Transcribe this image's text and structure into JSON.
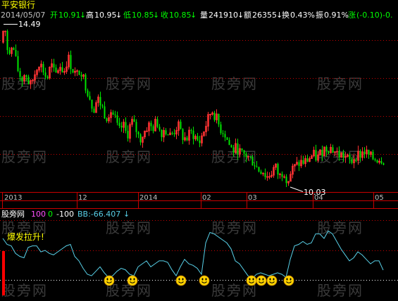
{
  "header": {
    "date": "2014/05/07",
    "open_label": "开",
    "open_value": "10.91",
    "high_label": "高",
    "high_value": "10.95",
    "low_label": "低",
    "low_value": "10.85",
    "close_label": "收",
    "close_value": "10.85",
    "volume_label": "量",
    "volume_value": "241910",
    "amount_label": "额",
    "amount_value": "26355",
    "turnover_label": "换",
    "turnover_value": "0.43%",
    "amplitude_label": "振",
    "amplitude_value": "0.91%",
    "change_label": "涨",
    "change_value": "(-0.10)-0."
  },
  "stock_name": "平安银行",
  "watermark": "股旁网",
  "indicator": {
    "name": "股旁网",
    "value_100": "100",
    "value_0": "0",
    "value_neg100": "-100",
    "bb_text": "BB:-66.407",
    "alert_text": "爆发拉升!"
  },
  "colors": {
    "background": "#000000",
    "up_candle": "#ff3232",
    "down_candle": "#00e600",
    "grid": "#c80000",
    "axis": "#c80000",
    "indicator_line": "#58d0e8",
    "smiley": "#ffd400",
    "date_text": "#c0c0c0",
    "yellow_text": "#ffff00",
    "green_text": "#00ff00",
    "magenta_text": "#ff50ff"
  },
  "chart_data": {
    "type": "candlestick",
    "annotations": {
      "high_label": "14.49",
      "low_label": "10.03"
    },
    "x_tick_labels": [
      "2013",
      "12",
      "2014",
      "02",
      "03",
      "04",
      "05"
    ],
    "price_trend": [
      [
        0,
        13.8
      ],
      [
        6,
        14.1
      ],
      [
        12,
        13.6
      ],
      [
        18,
        13.9
      ],
      [
        24,
        13.3
      ],
      [
        30,
        13.0
      ],
      [
        36,
        13.2
      ],
      [
        42,
        12.8
      ],
      [
        48,
        13.1
      ],
      [
        54,
        13.5
      ],
      [
        60,
        13.3
      ],
      [
        66,
        13.0
      ],
      [
        72,
        13.4
      ],
      [
        78,
        13.1
      ],
      [
        84,
        13.4
      ],
      [
        90,
        13.2
      ],
      [
        96,
        13.6
      ],
      [
        102,
        13.3
      ],
      [
        108,
        13.1
      ],
      [
        114,
        13.3
      ],
      [
        120,
        12.9
      ],
      [
        126,
        12.6
      ],
      [
        132,
        12.2
      ],
      [
        138,
        12.5
      ],
      [
        144,
        12.3
      ],
      [
        150,
        12.0
      ],
      [
        156,
        12.2
      ],
      [
        162,
        12.0
      ],
      [
        168,
        11.6
      ],
      [
        174,
        11.8
      ],
      [
        180,
        11.5
      ],
      [
        186,
        11.9
      ],
      [
        192,
        11.7
      ],
      [
        198,
        11.4
      ],
      [
        204,
        11.6
      ],
      [
        210,
        11.8
      ],
      [
        216,
        11.7
      ],
      [
        222,
        11.9
      ],
      [
        228,
        11.6
      ],
      [
        234,
        11.7
      ],
      [
        240,
        11.5
      ],
      [
        246,
        11.6
      ],
      [
        252,
        11.8
      ],
      [
        258,
        11.5
      ],
      [
        264,
        11.4
      ],
      [
        270,
        11.6
      ],
      [
        276,
        11.5
      ],
      [
        282,
        11.3
      ],
      [
        288,
        11.6
      ],
      [
        294,
        11.9
      ],
      [
        300,
        12.2
      ],
      [
        306,
        12.0
      ],
      [
        312,
        11.7
      ],
      [
        318,
        11.6
      ],
      [
        324,
        11.3
      ],
      [
        330,
        11.1
      ],
      [
        336,
        11.2
      ],
      [
        342,
        11.0
      ],
      [
        348,
        11.0
      ],
      [
        354,
        10.9
      ],
      [
        360,
        10.8
      ],
      [
        366,
        10.6
      ],
      [
        372,
        10.6
      ],
      [
        378,
        10.4
      ],
      [
        384,
        10.5
      ],
      [
        390,
        10.7
      ],
      [
        396,
        10.4
      ],
      [
        402,
        10.6
      ],
      [
        408,
        10.3
      ],
      [
        414,
        10.6
      ],
      [
        420,
        10.7
      ],
      [
        426,
        10.8
      ],
      [
        432,
        10.8
      ],
      [
        438,
        10.9
      ],
      [
        444,
        11.0
      ],
      [
        450,
        10.9
      ],
      [
        456,
        11.1
      ],
      [
        462,
        11.2
      ],
      [
        468,
        11.2
      ],
      [
        474,
        11.1
      ],
      [
        480,
        11.0
      ],
      [
        486,
        11.0
      ],
      [
        492,
        10.9
      ],
      [
        498,
        10.8
      ],
      [
        504,
        11.0
      ],
      [
        510,
        11.0
      ],
      [
        516,
        11.1
      ],
      [
        522,
        11.0
      ],
      [
        528,
        10.9
      ],
      [
        534,
        10.9
      ],
      [
        540,
        10.9
      ],
      [
        546,
        10.85
      ]
    ],
    "indicator_series": {
      "name": "BB",
      "ylim": [
        -100,
        100
      ],
      "points": [
        [
          4,
          40
        ],
        [
          10,
          20
        ],
        [
          16,
          15
        ],
        [
          22,
          -10
        ],
        [
          28,
          -20
        ],
        [
          34,
          -25
        ],
        [
          40,
          10
        ],
        [
          46,
          15
        ],
        [
          52,
          15
        ],
        [
          58,
          -5
        ],
        [
          64,
          0
        ],
        [
          70,
          -10
        ],
        [
          76,
          -15
        ],
        [
          82,
          -5
        ],
        [
          88,
          5
        ],
        [
          94,
          15
        ],
        [
          100,
          20
        ],
        [
          106,
          -20
        ],
        [
          112,
          -35
        ],
        [
          118,
          -60
        ],
        [
          124,
          -80
        ],
        [
          130,
          -85
        ],
        [
          136,
          -70
        ],
        [
          142,
          -55
        ],
        [
          148,
          -75
        ],
        [
          154,
          -90
        ],
        [
          160,
          -85
        ],
        [
          166,
          -70
        ],
        [
          172,
          -60
        ],
        [
          178,
          -65
        ],
        [
          184,
          -80
        ],
        [
          190,
          -85
        ],
        [
          196,
          -55
        ],
        [
          202,
          -45
        ],
        [
          208,
          -35
        ],
        [
          214,
          -55
        ],
        [
          220,
          -45
        ],
        [
          226,
          -35
        ],
        [
          232,
          -35
        ],
        [
          238,
          -40
        ],
        [
          244,
          -65
        ],
        [
          250,
          -85
        ],
        [
          256,
          -55
        ],
        [
          262,
          -30
        ],
        [
          268,
          -45
        ],
        [
          274,
          -50
        ],
        [
          280,
          -60
        ],
        [
          286,
          -80
        ],
        [
          292,
          25
        ],
        [
          298,
          60
        ],
        [
          304,
          55
        ],
        [
          310,
          45
        ],
        [
          316,
          35
        ],
        [
          322,
          25
        ],
        [
          328,
          5
        ],
        [
          334,
          -35
        ],
        [
          340,
          -45
        ],
        [
          346,
          -65
        ],
        [
          352,
          -85
        ],
        [
          358,
          -95
        ],
        [
          364,
          -80
        ],
        [
          370,
          -75
        ],
        [
          376,
          -80
        ],
        [
          382,
          -85
        ],
        [
          388,
          -80
        ],
        [
          394,
          -75
        ],
        [
          400,
          -80
        ],
        [
          406,
          -90
        ],
        [
          412,
          -30
        ],
        [
          418,
          15
        ],
        [
          424,
          20
        ],
        [
          430,
          30
        ],
        [
          436,
          20
        ],
        [
          442,
          25
        ],
        [
          448,
          55
        ],
        [
          454,
          55
        ],
        [
          460,
          40
        ],
        [
          466,
          65
        ],
        [
          472,
          55
        ],
        [
          478,
          30
        ],
        [
          484,
          5
        ],
        [
          490,
          -15
        ],
        [
          496,
          -35
        ],
        [
          502,
          -25
        ],
        [
          508,
          -5
        ],
        [
          514,
          -15
        ],
        [
          520,
          -30
        ],
        [
          526,
          -45
        ],
        [
          532,
          -35
        ],
        [
          538,
          -35
        ],
        [
          544,
          -66
        ]
      ]
    },
    "signal_points": [
      155,
      188,
      257,
      290,
      357,
      371,
      386,
      410
    ]
  }
}
